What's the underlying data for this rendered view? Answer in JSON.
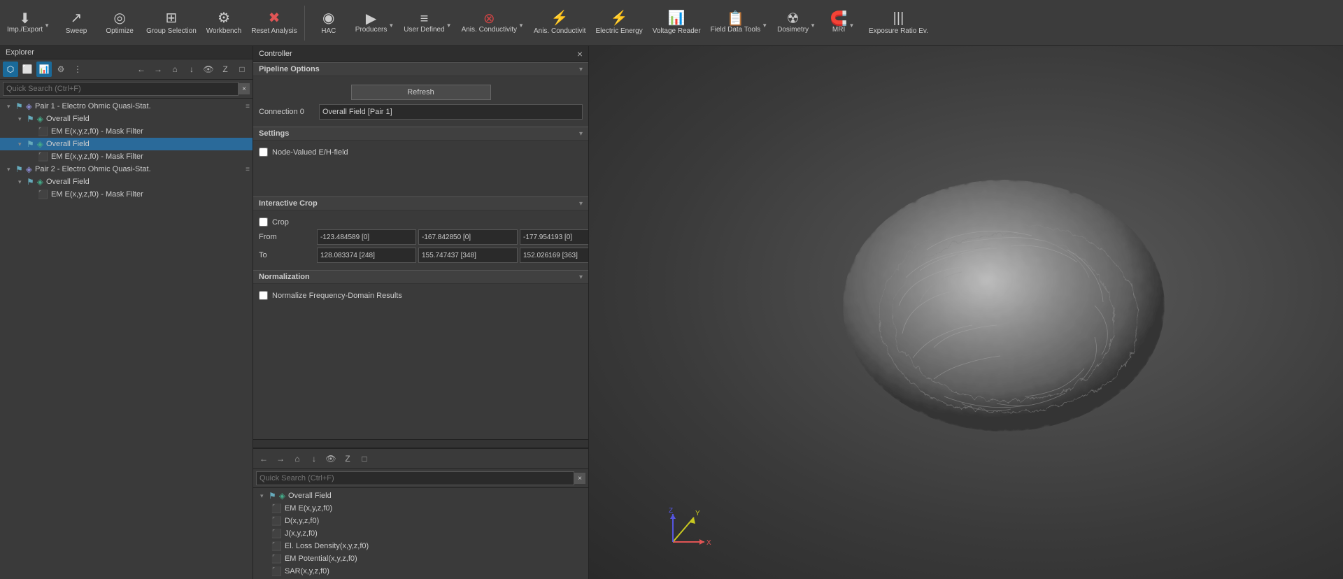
{
  "toolbar": {
    "items": [
      {
        "id": "imp-export",
        "label": "Imp./Export",
        "icon": "⬇",
        "hasArrow": true
      },
      {
        "id": "sweep",
        "label": "Sweep",
        "icon": "↗"
      },
      {
        "id": "optimize",
        "label": "Optimize",
        "icon": "◎"
      },
      {
        "id": "group-selection",
        "label": "Group Selection",
        "icon": "⊞"
      },
      {
        "id": "workbench",
        "label": "Workbench",
        "icon": "⚙"
      },
      {
        "id": "reset-analysis",
        "label": "Reset Analysis",
        "icon": "✖"
      },
      {
        "id": "hac",
        "label": "HAC",
        "icon": "◉"
      },
      {
        "id": "producers",
        "label": "Producers",
        "icon": "▶",
        "hasArrow": true
      },
      {
        "id": "user-defined",
        "label": "User Defined",
        "icon": "≡",
        "hasArrow": true
      },
      {
        "id": "anis-conductivity",
        "label": "Anis. Conductivity",
        "icon": "⊗",
        "hasArrow": true
      },
      {
        "id": "anis-conductivit",
        "label": "Anis. Conductivit",
        "icon": "⚡"
      },
      {
        "id": "electric-energy",
        "label": "Electric Energy",
        "icon": "⚡"
      },
      {
        "id": "voltage-reader",
        "label": "Voltage Reader",
        "icon": "📊"
      },
      {
        "id": "field-data-tools",
        "label": "Field Data Tools",
        "icon": "📋",
        "hasArrow": true
      },
      {
        "id": "dosimetry",
        "label": "Dosimetry",
        "icon": "☢",
        "hasArrow": true
      },
      {
        "id": "mri",
        "label": "MRI",
        "icon": "🧲",
        "hasArrow": true
      },
      {
        "id": "exposure-ratio",
        "label": "Exposure Ratio Ev.",
        "icon": "|||"
      }
    ]
  },
  "explorer": {
    "title": "Explorer",
    "search_placeholder": "Quick Search (Ctrl+F)",
    "tree": [
      {
        "id": "pair1",
        "level": 0,
        "text": "Pair 1 - Electro Ohmic Quasi-Stat.",
        "expanded": true,
        "hasArrow": true
      },
      {
        "id": "pair1-overall",
        "level": 1,
        "text": "Overall Field",
        "expanded": true,
        "hasArrow": true
      },
      {
        "id": "pair1-em",
        "level": 2,
        "text": "EM E(x,y,z,f0) - Mask Filter",
        "icon": "⬛"
      },
      {
        "id": "pair1-overall2",
        "level": 1,
        "text": "Overall Field",
        "expanded": true,
        "hasArrow": true,
        "selected": true
      },
      {
        "id": "pair1-em2",
        "level": 2,
        "text": "EM E(x,y,z,f0) - Mask Filter",
        "icon": "⬛"
      },
      {
        "id": "pair2",
        "level": 0,
        "text": "Pair 2 - Electro Ohmic Quasi-Stat.",
        "expanded": true,
        "hasArrow": true
      },
      {
        "id": "pair2-overall",
        "level": 1,
        "text": "Overall Field",
        "expanded": true,
        "hasArrow": true
      },
      {
        "id": "pair2-em",
        "level": 2,
        "text": "EM E(x,y,z,f0) - Mask Filter",
        "icon": "⬛"
      }
    ]
  },
  "controller": {
    "title": "Controller",
    "pipeline_options": "Pipeline Options",
    "refresh_label": "Refresh",
    "connection_label": "Connection 0",
    "connection_value": "Overall Field [Pair 1]",
    "settings_label": "Settings",
    "node_valued_label": "Node-Valued E/H-field",
    "interactive_crop_label": "Interactive Crop",
    "crop_label": "Crop",
    "from_label": "From",
    "to_label": "To",
    "from_values": [
      "-123.484589 [0]",
      "-167.842850 [0]",
      "-177.954193 [0]"
    ],
    "to_values": [
      "128.083374 [248]",
      "155.747437 [348]",
      "152.026169 [363]"
    ],
    "normalization_label": "Normalization",
    "normalize_label": "Normalize Frequency-Domain Results"
  },
  "bottom_tree": {
    "search_placeholder": "Quick Search (Ctrl+F)",
    "items": [
      {
        "id": "b-overall",
        "level": 0,
        "text": "Overall Field",
        "expanded": true
      },
      {
        "id": "b-em",
        "level": 1,
        "text": "EM E(x,y,z,f0)",
        "icon": "⬛"
      },
      {
        "id": "b-d",
        "level": 1,
        "text": "D(x,y,z,f0)",
        "icon": "⬛"
      },
      {
        "id": "b-j",
        "level": 1,
        "text": "J(x,y,z,f0)",
        "icon": "⬛"
      },
      {
        "id": "b-el",
        "level": 1,
        "text": "El. Loss Density(x,y,z,f0)",
        "icon": "⬛"
      },
      {
        "id": "b-emp",
        "level": 1,
        "text": "EM Potential(x,y,z,f0)",
        "icon": "⬛"
      },
      {
        "id": "b-sar",
        "level": 1,
        "text": "SAR(x,y,z,f0)",
        "icon": "⬛"
      }
    ]
  },
  "icons": {
    "close": "×",
    "collapse": "▾",
    "expand": "▸",
    "arrow_down": "▼",
    "arrow_right": "▶",
    "back": "←",
    "forward": "→",
    "home": "⌂",
    "download": "↓",
    "eye": "👁",
    "z": "Z",
    "square": "□"
  }
}
